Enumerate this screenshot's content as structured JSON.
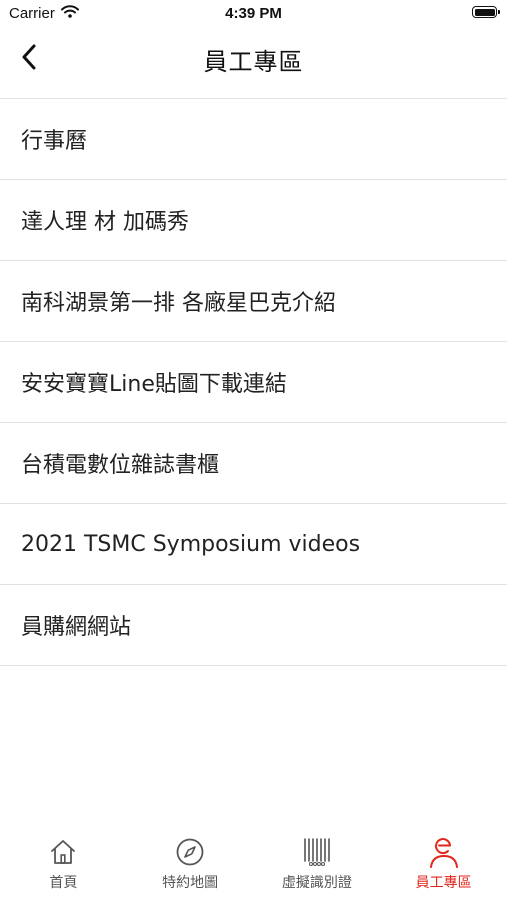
{
  "status_bar": {
    "carrier": "Carrier",
    "time": "4:39 PM"
  },
  "nav": {
    "title": "員工專區"
  },
  "list": {
    "items": [
      {
        "label": "行事曆"
      },
      {
        "label": "達人理 材 加碼秀"
      },
      {
        "label": "南科湖景第一排 各廠星巴克介紹"
      },
      {
        "label": "安安寶寶Line貼圖下載連結"
      },
      {
        "label": "台積電數位雜誌書櫃"
      },
      {
        "label": "2021 TSMC Symposium videos"
      },
      {
        "label": "員購網網站"
      }
    ]
  },
  "tab_bar": {
    "active_color": "#e1251b",
    "tabs": [
      {
        "label": "首頁",
        "icon": "home-icon"
      },
      {
        "label": "特約地圖",
        "icon": "compass-icon"
      },
      {
        "label": "虛擬識別證",
        "icon": "barcode-icon"
      },
      {
        "label": "員工專區",
        "icon": "person-icon",
        "active": true
      }
    ]
  }
}
